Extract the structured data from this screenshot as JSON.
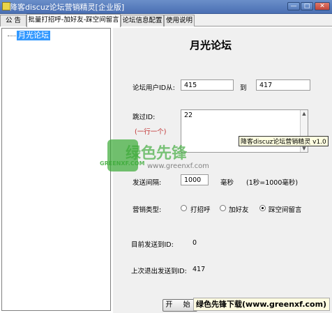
{
  "window": {
    "title": "降客discuz论坛营销精灵[企业版]",
    "min_label": "—",
    "max_label": "□",
    "close_label": "✕"
  },
  "tabs": [
    {
      "label": "公 告",
      "active": false
    },
    {
      "label": "批量打招呼-加好友-踩空间留言",
      "active": true
    },
    {
      "label": "论坛信息配置",
      "active": false
    },
    {
      "label": "使用说明",
      "active": false
    }
  ],
  "tree": {
    "items": [
      {
        "label": "月光论坛",
        "selected": true
      }
    ]
  },
  "form": {
    "forum_title": "月光论坛",
    "user_id_label": "论坛用户ID从:",
    "user_id_from": "415",
    "to_label": "到",
    "user_id_to": "417",
    "skip_label": "跳过ID:",
    "skip_hint": "(一行一个)",
    "skip_value": "22",
    "interval_label": "发送间隔:",
    "interval_value": "1000",
    "interval_unit": "毫秒",
    "interval_note": "(1秒=1000毫秒)",
    "mode_label": "营销类型:",
    "modes": [
      {
        "label": "打招呼",
        "selected": false
      },
      {
        "label": "加好友",
        "selected": false
      },
      {
        "label": "踩空间留言",
        "selected": true
      }
    ],
    "current_id_label": "目前发送到ID:",
    "current_id_value": "0",
    "last_id_label": "上次退出发送到ID:",
    "last_id_value": "417",
    "start_label": "开 始"
  },
  "tooltip": "降客discuz论坛营销精灵 v1.0",
  "watermark": {
    "logo_text": "GREENXF.COM",
    "name": "绿色先锋",
    "url": "www.greenxf.com",
    "banner": "绿色先锋下载(www.greenxf.com)",
    "color": "#39a935"
  },
  "colors": {
    "titlebar": "#4a6fb3",
    "selection": "#3399ff",
    "panel": "#f0f0f0"
  }
}
